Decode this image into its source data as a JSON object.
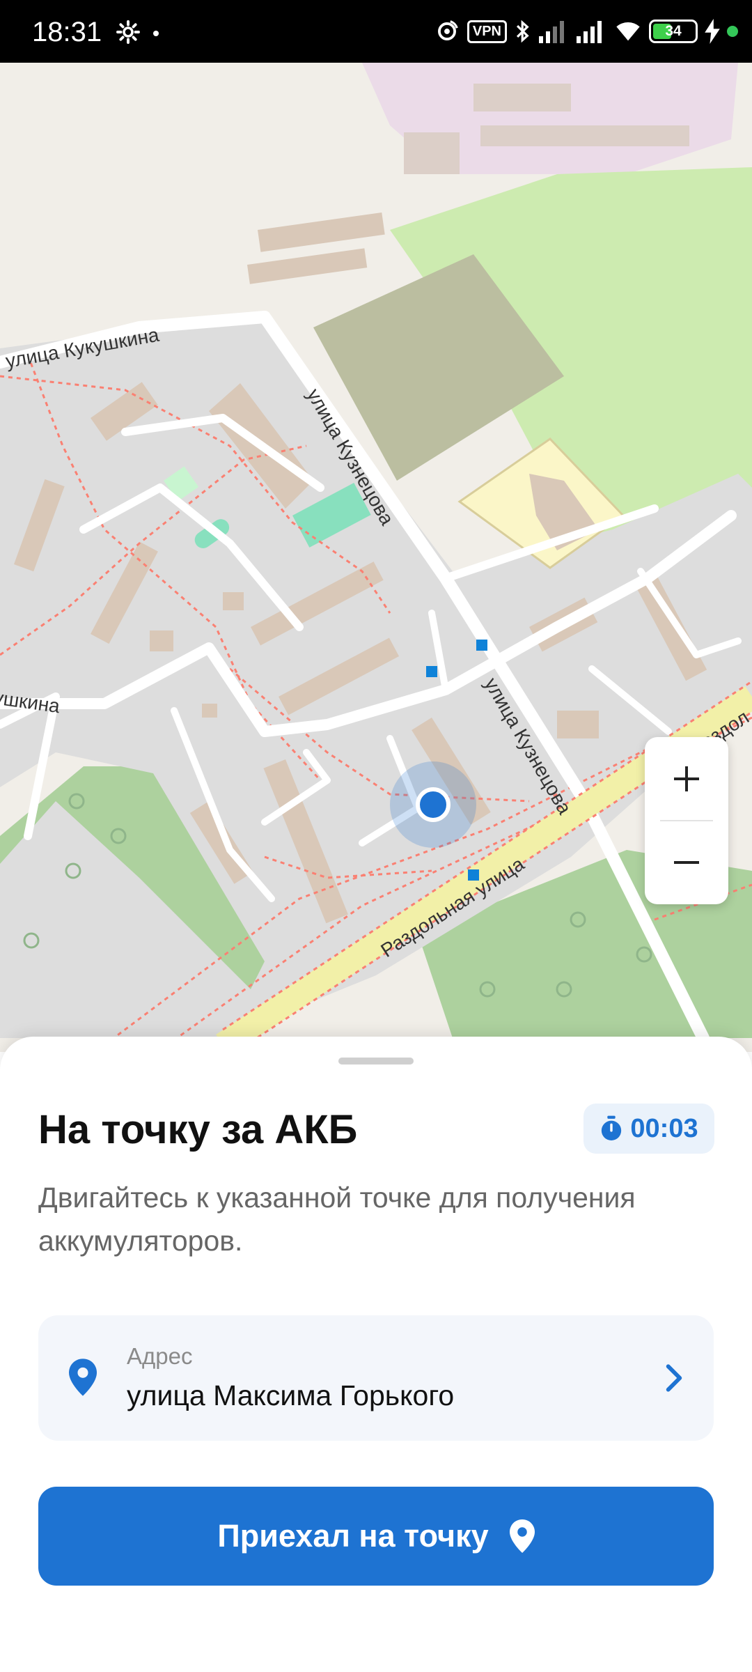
{
  "status_bar": {
    "time": "18:31",
    "vpn": "VPN",
    "battery": "34"
  },
  "map": {
    "streets": {
      "kukushkina": "улица Кукушкина",
      "kukushkina_part": "ушкина",
      "kuznetsova_top": "улица Кузнецова",
      "kuznetsova_bottom": "улица Кузнецова",
      "razdolnaya": "Раздольная улица",
      "razdolnaya_part": "Раздол"
    },
    "zoom_in": "+",
    "zoom_out": "−"
  },
  "sheet": {
    "title": "На точку за АКБ",
    "timer": "00:03",
    "description": "Двигайтесь к указанной точке для получения аккумуляторов.",
    "address": {
      "label": "Адрес",
      "value": "улица Максима Горького"
    },
    "arrived_button": "Приехал на точку"
  },
  "colors": {
    "accent": "#1e73d2",
    "timer_bg": "#eaf2fb",
    "card_bg": "#f3f6fb"
  }
}
